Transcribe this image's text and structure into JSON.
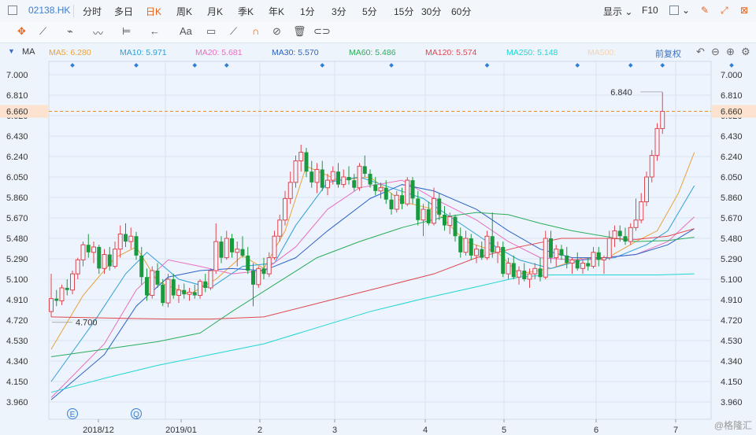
{
  "toolbar": {
    "code": "02138.HK",
    "periods": [
      "分时",
      "多日",
      "日K",
      "周K",
      "月K",
      "季K",
      "年K",
      "1分",
      "3分",
      "5分",
      "15分",
      "30分",
      "60分"
    ],
    "active_period": "日K",
    "display_label": "显示",
    "f10_label": "F10"
  },
  "drawing_tools": [
    "move-icon",
    "line-icon",
    "ray-icon",
    "wave-icon",
    "channel-icon",
    "arrow-icon",
    "text-icon",
    "comment-icon",
    "ruler-icon",
    "magnet-icon",
    "hide-icon",
    "delete-icon",
    "link-icon"
  ],
  "text_tool_label": "Aa",
  "ma_bar": {
    "label": "MA",
    "items": [
      {
        "text": "MA5: 6.280",
        "color": "#e8a23b"
      },
      {
        "text": "MA10: 5.971",
        "color": "#2f9fd6"
      },
      {
        "text": "MA20: 5.681",
        "color": "#e86fc0"
      },
      {
        "text": "MA30: 5.570",
        "color": "#2d62c9"
      },
      {
        "text": "MA60: 5.486",
        "color": "#2aad5a"
      },
      {
        "text": "MA120: 5.574",
        "color": "#e0464f"
      },
      {
        "text": "MA250: 5.148",
        "color": "#1ed6d6"
      },
      {
        "text": "MA500:",
        "color": "#f3d3b4"
      }
    ],
    "adjust_label": "前复权"
  },
  "colors": {
    "up": "#e0464f",
    "down": "#1a9a3e",
    "current_line": "#f08a2a",
    "current_label_bg": "#fde3cf",
    "current_label_text": "#e0464f"
  },
  "watermark": "@格隆汇",
  "chart_data": {
    "type": "candlestick",
    "y_ticks": [
      "7.000",
      "6.810",
      "6.620",
      "6.430",
      "6.240",
      "6.050",
      "5.860",
      "5.670",
      "5.480",
      "5.290",
      "5.100",
      "4.910",
      "4.720",
      "4.530",
      "4.340",
      "4.150",
      "3.960"
    ],
    "ylim": [
      3.96,
      7.0
    ],
    "current_price_label": "6.660",
    "current_price": 6.66,
    "high_annotation": "6.840",
    "low_annotation": "4.700",
    "x_labels": [
      "2018/12",
      "2019/01",
      "2",
      "3",
      "4",
      "5",
      "6",
      "7"
    ],
    "x_label_index": [
      9,
      30,
      55,
      75,
      98,
      117,
      139,
      158
    ],
    "marker_index": [
      4,
      16,
      27,
      33,
      51,
      64,
      82,
      99,
      109,
      115,
      128,
      138,
      147,
      152,
      154
    ],
    "event_markers": [
      {
        "index": 4,
        "label": "E"
      },
      {
        "index": 16,
        "label": "Q"
      },
      {
        "index": 152,
        "label": "E"
      }
    ],
    "ohlc": [
      [
        4.8,
        5.15,
        4.75,
        4.92
      ],
      [
        4.92,
        5.0,
        4.85,
        4.9
      ],
      [
        4.9,
        5.05,
        4.86,
        5.02
      ],
      [
        5.02,
        5.1,
        4.95,
        5.0
      ],
      [
        5.0,
        5.18,
        4.96,
        5.15
      ],
      [
        5.15,
        5.3,
        5.1,
        5.28
      ],
      [
        5.28,
        5.45,
        5.22,
        5.42
      ],
      [
        5.42,
        5.52,
        5.3,
        5.35
      ],
      [
        5.35,
        5.45,
        5.25,
        5.4
      ],
      [
        5.4,
        5.42,
        5.15,
        5.2
      ],
      [
        5.2,
        5.38,
        5.15,
        5.33
      ],
      [
        5.33,
        5.4,
        5.18,
        5.22
      ],
      [
        5.22,
        5.45,
        5.2,
        5.38
      ],
      [
        5.38,
        5.6,
        5.3,
        5.52
      ],
      [
        5.52,
        5.62,
        5.4,
        5.45
      ],
      [
        5.45,
        5.58,
        5.38,
        5.5
      ],
      [
        5.5,
        5.54,
        5.28,
        5.32
      ],
      [
        5.32,
        5.4,
        5.05,
        5.12
      ],
      [
        5.12,
        5.2,
        4.9,
        4.95
      ],
      [
        4.95,
        5.22,
        4.92,
        5.18
      ],
      [
        5.18,
        5.25,
        5.02,
        5.05
      ],
      [
        5.05,
        5.1,
        4.85,
        4.88
      ],
      [
        4.88,
        5.15,
        4.84,
        5.1
      ],
      [
        5.1,
        5.15,
        4.92,
        4.95
      ],
      [
        4.95,
        5.05,
        4.88,
        5.0
      ],
      [
        5.0,
        5.06,
        4.92,
        4.96
      ],
      [
        4.96,
        5.02,
        4.9,
        4.98
      ],
      [
        4.98,
        5.05,
        4.92,
        4.95
      ],
      [
        4.95,
        5.1,
        4.92,
        5.08
      ],
      [
        5.08,
        5.15,
        4.98,
        5.02
      ],
      [
        5.02,
        5.2,
        5.0,
        5.18
      ],
      [
        5.18,
        5.62,
        5.15,
        5.45
      ],
      [
        5.45,
        5.5,
        5.25,
        5.3
      ],
      [
        5.3,
        5.55,
        5.28,
        5.48
      ],
      [
        5.48,
        5.52,
        5.3,
        5.35
      ],
      [
        5.35,
        5.45,
        5.22,
        5.38
      ],
      [
        5.38,
        5.5,
        5.3,
        5.32
      ],
      [
        5.32,
        5.4,
        5.15,
        5.18
      ],
      [
        5.18,
        5.25,
        4.85,
        5.05
      ],
      [
        5.05,
        5.22,
        5.02,
        5.2
      ],
      [
        5.2,
        5.3,
        5.1,
        5.15
      ],
      [
        5.15,
        5.35,
        5.12,
        5.3
      ],
      [
        5.3,
        5.55,
        5.28,
        5.5
      ],
      [
        5.5,
        5.7,
        5.45,
        5.65
      ],
      [
        5.65,
        5.92,
        5.6,
        5.85
      ],
      [
        5.85,
        6.1,
        5.8,
        6.0
      ],
      [
        6.0,
        6.25,
        5.95,
        6.2
      ],
      [
        6.2,
        6.35,
        6.1,
        6.28
      ],
      [
        6.28,
        6.32,
        6.05,
        6.1
      ],
      [
        6.1,
        6.2,
        5.95,
        6.0
      ],
      [
        6.0,
        6.18,
        5.9,
        6.12
      ],
      [
        6.12,
        6.2,
        5.92,
        5.95
      ],
      [
        5.95,
        6.08,
        5.88,
        6.02
      ],
      [
        6.02,
        6.15,
        5.98,
        6.1
      ],
      [
        6.1,
        6.18,
        5.95,
        5.98
      ],
      [
        5.98,
        6.12,
        5.95,
        6.05
      ],
      [
        6.05,
        6.15,
        5.98,
        6.02
      ],
      [
        6.02,
        6.08,
        5.92,
        5.95
      ],
      [
        5.95,
        6.18,
        5.92,
        6.15
      ],
      [
        6.15,
        6.25,
        6.05,
        6.08
      ],
      [
        6.08,
        6.12,
        5.95,
        5.98
      ],
      [
        5.98,
        6.05,
        5.88,
        5.92
      ],
      [
        5.92,
        6.0,
        5.85,
        5.95
      ],
      [
        5.95,
        6.02,
        5.8,
        5.84
      ],
      [
        5.84,
        5.9,
        5.7,
        5.75
      ],
      [
        5.75,
        5.92,
        5.72,
        5.88
      ],
      [
        5.88,
        5.95,
        5.75,
        5.8
      ],
      [
        5.8,
        6.05,
        5.78,
        6.02
      ],
      [
        6.02,
        6.05,
        5.8,
        5.85
      ],
      [
        5.85,
        5.92,
        5.6,
        5.65
      ],
      [
        5.65,
        5.8,
        5.5,
        5.75
      ],
      [
        5.75,
        5.82,
        5.6,
        5.62
      ],
      [
        5.62,
        5.95,
        5.6,
        5.85
      ],
      [
        5.85,
        5.9,
        5.65,
        5.7
      ],
      [
        5.7,
        5.78,
        5.55,
        5.6
      ],
      [
        5.6,
        5.72,
        5.52,
        5.68
      ],
      [
        5.68,
        5.7,
        5.45,
        5.5
      ],
      [
        5.5,
        5.58,
        5.3,
        5.35
      ],
      [
        5.35,
        5.55,
        5.32,
        5.48
      ],
      [
        5.48,
        5.52,
        5.28,
        5.32
      ],
      [
        5.32,
        5.42,
        5.25,
        5.38
      ],
      [
        5.38,
        5.45,
        5.28,
        5.3
      ],
      [
        5.3,
        5.55,
        5.28,
        5.5
      ],
      [
        5.5,
        5.72,
        5.3,
        5.35
      ],
      [
        5.35,
        5.45,
        5.25,
        5.4
      ],
      [
        5.4,
        5.45,
        5.12,
        5.15
      ],
      [
        5.15,
        5.3,
        5.1,
        5.25
      ],
      [
        5.25,
        5.32,
        5.1,
        5.12
      ],
      [
        5.12,
        5.22,
        5.05,
        5.18
      ],
      [
        5.18,
        5.25,
        5.08,
        5.1
      ],
      [
        5.1,
        5.2,
        5.02,
        5.15
      ],
      [
        5.15,
        5.25,
        5.1,
        5.2
      ],
      [
        5.2,
        5.3,
        5.08,
        5.12
      ],
      [
        5.12,
        5.55,
        5.1,
        5.48
      ],
      [
        5.48,
        5.55,
        5.25,
        5.3
      ],
      [
        5.3,
        5.42,
        5.22,
        5.38
      ],
      [
        5.38,
        5.42,
        5.28,
        5.32
      ],
      [
        5.32,
        5.4,
        5.2,
        5.25
      ],
      [
        5.25,
        5.3,
        5.15,
        5.28
      ],
      [
        5.28,
        5.35,
        5.18,
        5.2
      ],
      [
        5.2,
        5.28,
        5.15,
        5.25
      ],
      [
        5.25,
        5.3,
        5.18,
        5.22
      ],
      [
        5.22,
        5.4,
        5.2,
        5.35
      ],
      [
        5.35,
        5.4,
        5.22,
        5.28
      ],
      [
        5.28,
        5.32,
        5.15,
        5.3
      ],
      [
        5.3,
        5.55,
        5.28,
        5.48
      ],
      [
        5.48,
        5.6,
        5.4,
        5.55
      ],
      [
        5.55,
        5.6,
        5.45,
        5.5
      ],
      [
        5.5,
        5.58,
        5.42,
        5.45
      ],
      [
        5.45,
        5.62,
        5.42,
        5.58
      ],
      [
        5.58,
        5.85,
        5.55,
        5.65
      ],
      [
        5.65,
        5.9,
        5.62,
        5.82
      ],
      [
        5.82,
        6.1,
        5.78,
        6.05
      ],
      [
        6.05,
        6.3,
        6.0,
        6.25
      ],
      [
        6.25,
        6.55,
        6.2,
        6.5
      ],
      [
        6.5,
        6.84,
        6.45,
        6.66
      ]
    ],
    "ma_lines": [
      {
        "name": "MA5",
        "color": "#e8a23b",
        "values": [
          [
            0,
            4.45
          ],
          [
            6,
            4.95
          ],
          [
            12,
            5.3
          ],
          [
            16,
            5.4
          ],
          [
            20,
            5.08
          ],
          [
            26,
            4.96
          ],
          [
            31,
            5.1
          ],
          [
            36,
            5.32
          ],
          [
            40,
            5.2
          ],
          [
            44,
            5.55
          ],
          [
            48,
            6.15
          ],
          [
            54,
            6.02
          ],
          [
            60,
            6.05
          ],
          [
            66,
            5.82
          ],
          [
            72,
            5.75
          ],
          [
            78,
            5.45
          ],
          [
            84,
            5.35
          ],
          [
            88,
            5.15
          ],
          [
            94,
            5.2
          ],
          [
            100,
            5.3
          ],
          [
            104,
            5.28
          ],
          [
            110,
            5.45
          ],
          [
            114,
            5.55
          ],
          [
            118,
            5.9
          ],
          [
            121,
            6.28
          ]
        ]
      },
      {
        "name": "MA10",
        "color": "#2f9fd6",
        "values": [
          [
            0,
            4.15
          ],
          [
            8,
            4.7
          ],
          [
            14,
            5.15
          ],
          [
            18,
            5.35
          ],
          [
            24,
            5.1
          ],
          [
            30,
            5.02
          ],
          [
            36,
            5.22
          ],
          [
            42,
            5.25
          ],
          [
            46,
            5.6
          ],
          [
            52,
            6.0
          ],
          [
            58,
            6.05
          ],
          [
            64,
            5.95
          ],
          [
            70,
            5.85
          ],
          [
            76,
            5.65
          ],
          [
            82,
            5.45
          ],
          [
            88,
            5.28
          ],
          [
            94,
            5.2
          ],
          [
            100,
            5.28
          ],
          [
            106,
            5.3
          ],
          [
            112,
            5.42
          ],
          [
            116,
            5.55
          ],
          [
            121,
            5.97
          ]
        ]
      },
      {
        "name": "MA20",
        "color": "#e86fc0",
        "values": [
          [
            0,
            4.0
          ],
          [
            10,
            4.5
          ],
          [
            16,
            5.0
          ],
          [
            22,
            5.28
          ],
          [
            28,
            5.22
          ],
          [
            34,
            5.15
          ],
          [
            40,
            5.18
          ],
          [
            46,
            5.4
          ],
          [
            52,
            5.75
          ],
          [
            58,
            5.95
          ],
          [
            66,
            6.02
          ],
          [
            72,
            5.85
          ],
          [
            80,
            5.65
          ],
          [
            86,
            5.45
          ],
          [
            92,
            5.3
          ],
          [
            98,
            5.28
          ],
          [
            104,
            5.3
          ],
          [
            110,
            5.33
          ],
          [
            116,
            5.45
          ],
          [
            121,
            5.68
          ]
        ]
      },
      {
        "name": "MA30",
        "color": "#2d62c9",
        "values": [
          [
            0,
            3.98
          ],
          [
            10,
            4.4
          ],
          [
            16,
            4.85
          ],
          [
            22,
            5.12
          ],
          [
            28,
            5.18
          ],
          [
            34,
            5.2
          ],
          [
            40,
            5.18
          ],
          [
            46,
            5.3
          ],
          [
            52,
            5.55
          ],
          [
            60,
            5.85
          ],
          [
            66,
            5.98
          ],
          [
            72,
            5.92
          ],
          [
            80,
            5.75
          ],
          [
            86,
            5.55
          ],
          [
            92,
            5.38
          ],
          [
            98,
            5.3
          ],
          [
            104,
            5.3
          ],
          [
            110,
            5.33
          ],
          [
            116,
            5.42
          ],
          [
            121,
            5.57
          ]
        ]
      },
      {
        "name": "MA60",
        "color": "#2aad5a",
        "values": [
          [
            0,
            4.38
          ],
          [
            10,
            4.45
          ],
          [
            20,
            4.52
          ],
          [
            28,
            4.6
          ],
          [
            34,
            4.8
          ],
          [
            42,
            5.05
          ],
          [
            50,
            5.3
          ],
          [
            58,
            5.45
          ],
          [
            66,
            5.58
          ],
          [
            74,
            5.68
          ],
          [
            80,
            5.72
          ],
          [
            86,
            5.7
          ],
          [
            92,
            5.62
          ],
          [
            98,
            5.55
          ],
          [
            104,
            5.5
          ],
          [
            110,
            5.45
          ],
          [
            116,
            5.46
          ],
          [
            121,
            5.49
          ]
        ]
      },
      {
        "name": "MA120",
        "color": "#e0464f",
        "values": [
          [
            0,
            4.75
          ],
          [
            10,
            4.74
          ],
          [
            22,
            4.73
          ],
          [
            30,
            4.73
          ],
          [
            40,
            4.75
          ],
          [
            48,
            4.85
          ],
          [
            56,
            4.95
          ],
          [
            64,
            5.05
          ],
          [
            72,
            5.15
          ],
          [
            80,
            5.3
          ],
          [
            88,
            5.4
          ],
          [
            96,
            5.48
          ],
          [
            104,
            5.48
          ],
          [
            110,
            5.47
          ],
          [
            116,
            5.5
          ],
          [
            121,
            5.57
          ]
        ]
      },
      {
        "name": "MA250",
        "color": "#1ed6d6",
        "values": [
          [
            0,
            4.05
          ],
          [
            10,
            4.18
          ],
          [
            20,
            4.3
          ],
          [
            30,
            4.4
          ],
          [
            40,
            4.5
          ],
          [
            50,
            4.65
          ],
          [
            60,
            4.8
          ],
          [
            70,
            4.92
          ],
          [
            80,
            5.03
          ],
          [
            88,
            5.12
          ],
          [
            94,
            5.14
          ],
          [
            104,
            5.14
          ],
          [
            114,
            5.14
          ],
          [
            121,
            5.15
          ]
        ]
      }
    ]
  }
}
